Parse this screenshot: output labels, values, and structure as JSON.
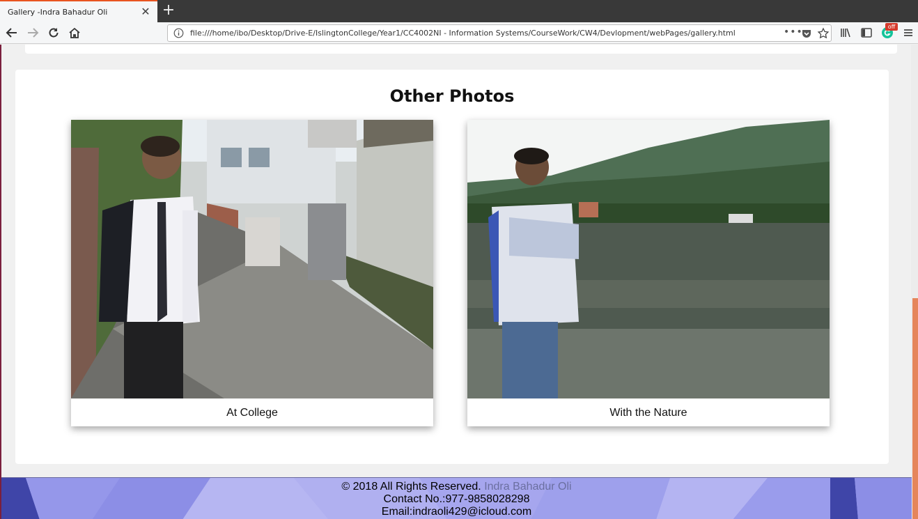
{
  "browser": {
    "tab_title": "Gallery -Indra Bahadur Oli",
    "url": "file:///home/ibo/Desktop/Drive-E/IslingtonCollege/Year1/CC4002NI - Information Systems/CourseWork/CW4/Devlopment/webPages/gallery.html",
    "extension_badge": "off",
    "icons": [
      "back-icon",
      "forward-icon",
      "reload-icon",
      "home-icon",
      "info-icon",
      "page-actions-icon",
      "pocket-icon",
      "bookmark-star-icon",
      "library-icon",
      "sidebar-icon",
      "grammarly-icon",
      "menu-icon"
    ]
  },
  "gallery": {
    "section_title": "Other Photos",
    "photos": [
      {
        "caption": "At College"
      },
      {
        "caption": "With the Nature"
      }
    ]
  },
  "footer": {
    "copyright": "© 2018 All Rights Reserved.",
    "author": "Indra Bahadur Oli",
    "contact": "Contact No.:977-9858028298",
    "email": "Email:indraoli429@icloud.com"
  },
  "colors": {
    "tab_accent": "#e95420",
    "footer_author": "#6b6fa0",
    "scroll_thumb": "#e5855b"
  }
}
